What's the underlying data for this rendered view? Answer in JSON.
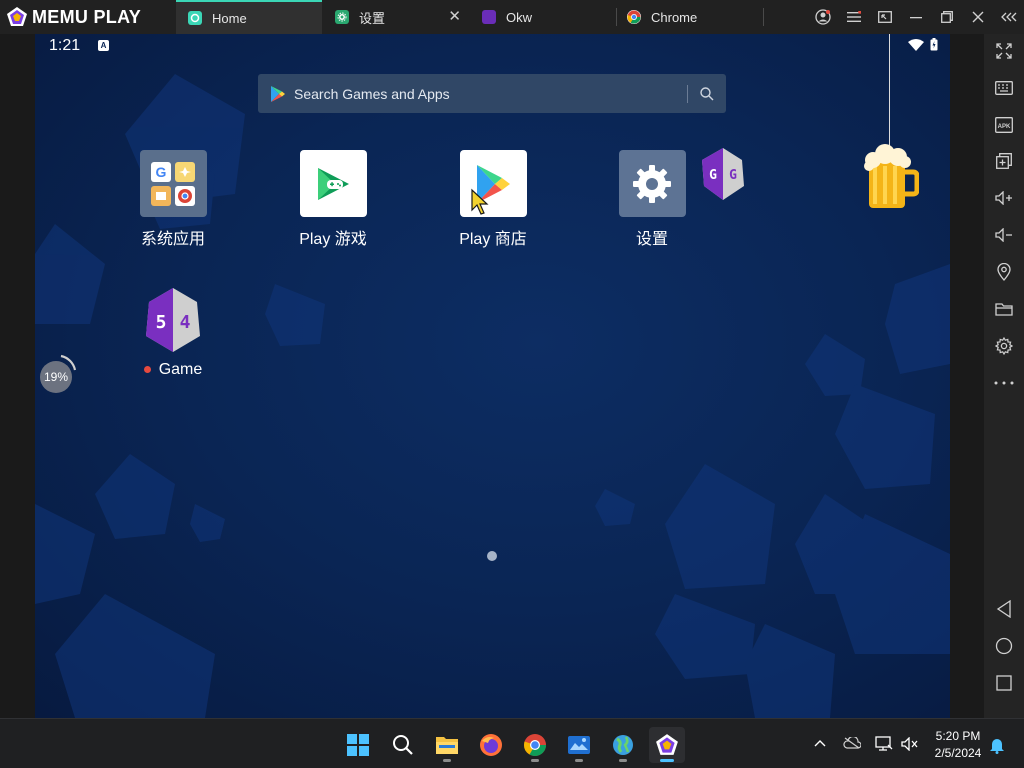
{
  "brand": {
    "name": "MEMU PLAY"
  },
  "tabs": [
    {
      "label": "Home",
      "active": true
    },
    {
      "label": "设置",
      "active": false
    },
    {
      "label": "Okw",
      "active": false
    },
    {
      "label": "Chrome",
      "active": false
    }
  ],
  "status": {
    "time": "1:21",
    "indicator": "A"
  },
  "search": {
    "placeholder": "Search Games and Apps"
  },
  "apps": [
    {
      "label": "系统应用",
      "icon": "folder-icon"
    },
    {
      "label": "Play 游戏",
      "icon": "play-games-icon"
    },
    {
      "label": "Play 商店",
      "icon": "play-store-icon"
    },
    {
      "label": "设置",
      "icon": "settings-icon"
    },
    {
      "label": "Game",
      "icon": "game-guardian-icon"
    }
  ],
  "progress": {
    "label": "19%",
    "value": 0.19
  },
  "taskbar": {
    "time": "5:20 PM",
    "date": "2/5/2024"
  },
  "colors": {
    "accent": "#3bd6b6",
    "screen_bg": "#0a2554",
    "taskbar_active": "#4cc2ff"
  }
}
